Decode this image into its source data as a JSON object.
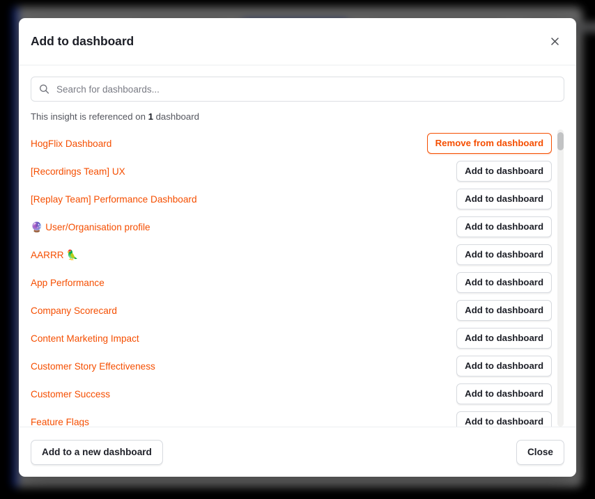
{
  "modal": {
    "title": "Add to dashboard",
    "close_icon": "close-icon"
  },
  "search": {
    "placeholder": "Search for dashboards...",
    "value": "",
    "icon": "search-icon"
  },
  "reference_note": {
    "prefix": "This insight is referenced on ",
    "count": "1",
    "suffix": " dashboard"
  },
  "buttons": {
    "add_label": "Add to dashboard",
    "remove_label": "Remove from dashboard"
  },
  "dashboards": [
    {
      "name": "HogFlix Dashboard",
      "emoji_before": "",
      "emoji_after": "",
      "added": true
    },
    {
      "name": "[Recordings Team] UX",
      "emoji_before": "",
      "emoji_after": "",
      "added": false
    },
    {
      "name": "[Replay Team] Performance Dashboard",
      "emoji_before": "",
      "emoji_after": "",
      "added": false
    },
    {
      "name": "User/Organisation profile",
      "emoji_before": "🔮",
      "emoji_after": "",
      "added": false
    },
    {
      "name": "AARRR",
      "emoji_before": "",
      "emoji_after": "🦜",
      "added": false
    },
    {
      "name": "App Performance",
      "emoji_before": "",
      "emoji_after": "",
      "added": false
    },
    {
      "name": "Company Scorecard",
      "emoji_before": "",
      "emoji_after": "",
      "added": false
    },
    {
      "name": "Content Marketing Impact",
      "emoji_before": "",
      "emoji_after": "",
      "added": false
    },
    {
      "name": "Customer Story Effectiveness",
      "emoji_before": "",
      "emoji_after": "",
      "added": false
    },
    {
      "name": "Customer Success",
      "emoji_before": "",
      "emoji_after": "",
      "added": false
    },
    {
      "name": "Feature Flags",
      "emoji_before": "",
      "emoji_after": "",
      "added": false
    }
  ],
  "footer": {
    "new_dashboard_label": "Add to a new dashboard",
    "close_label": "Close"
  },
  "colors": {
    "brand_orange": "#f54e00",
    "text_dark": "#1d1f27",
    "text_muted": "#54565e",
    "border": "#d6d9de",
    "backdrop_blue": "#1d4aff"
  }
}
